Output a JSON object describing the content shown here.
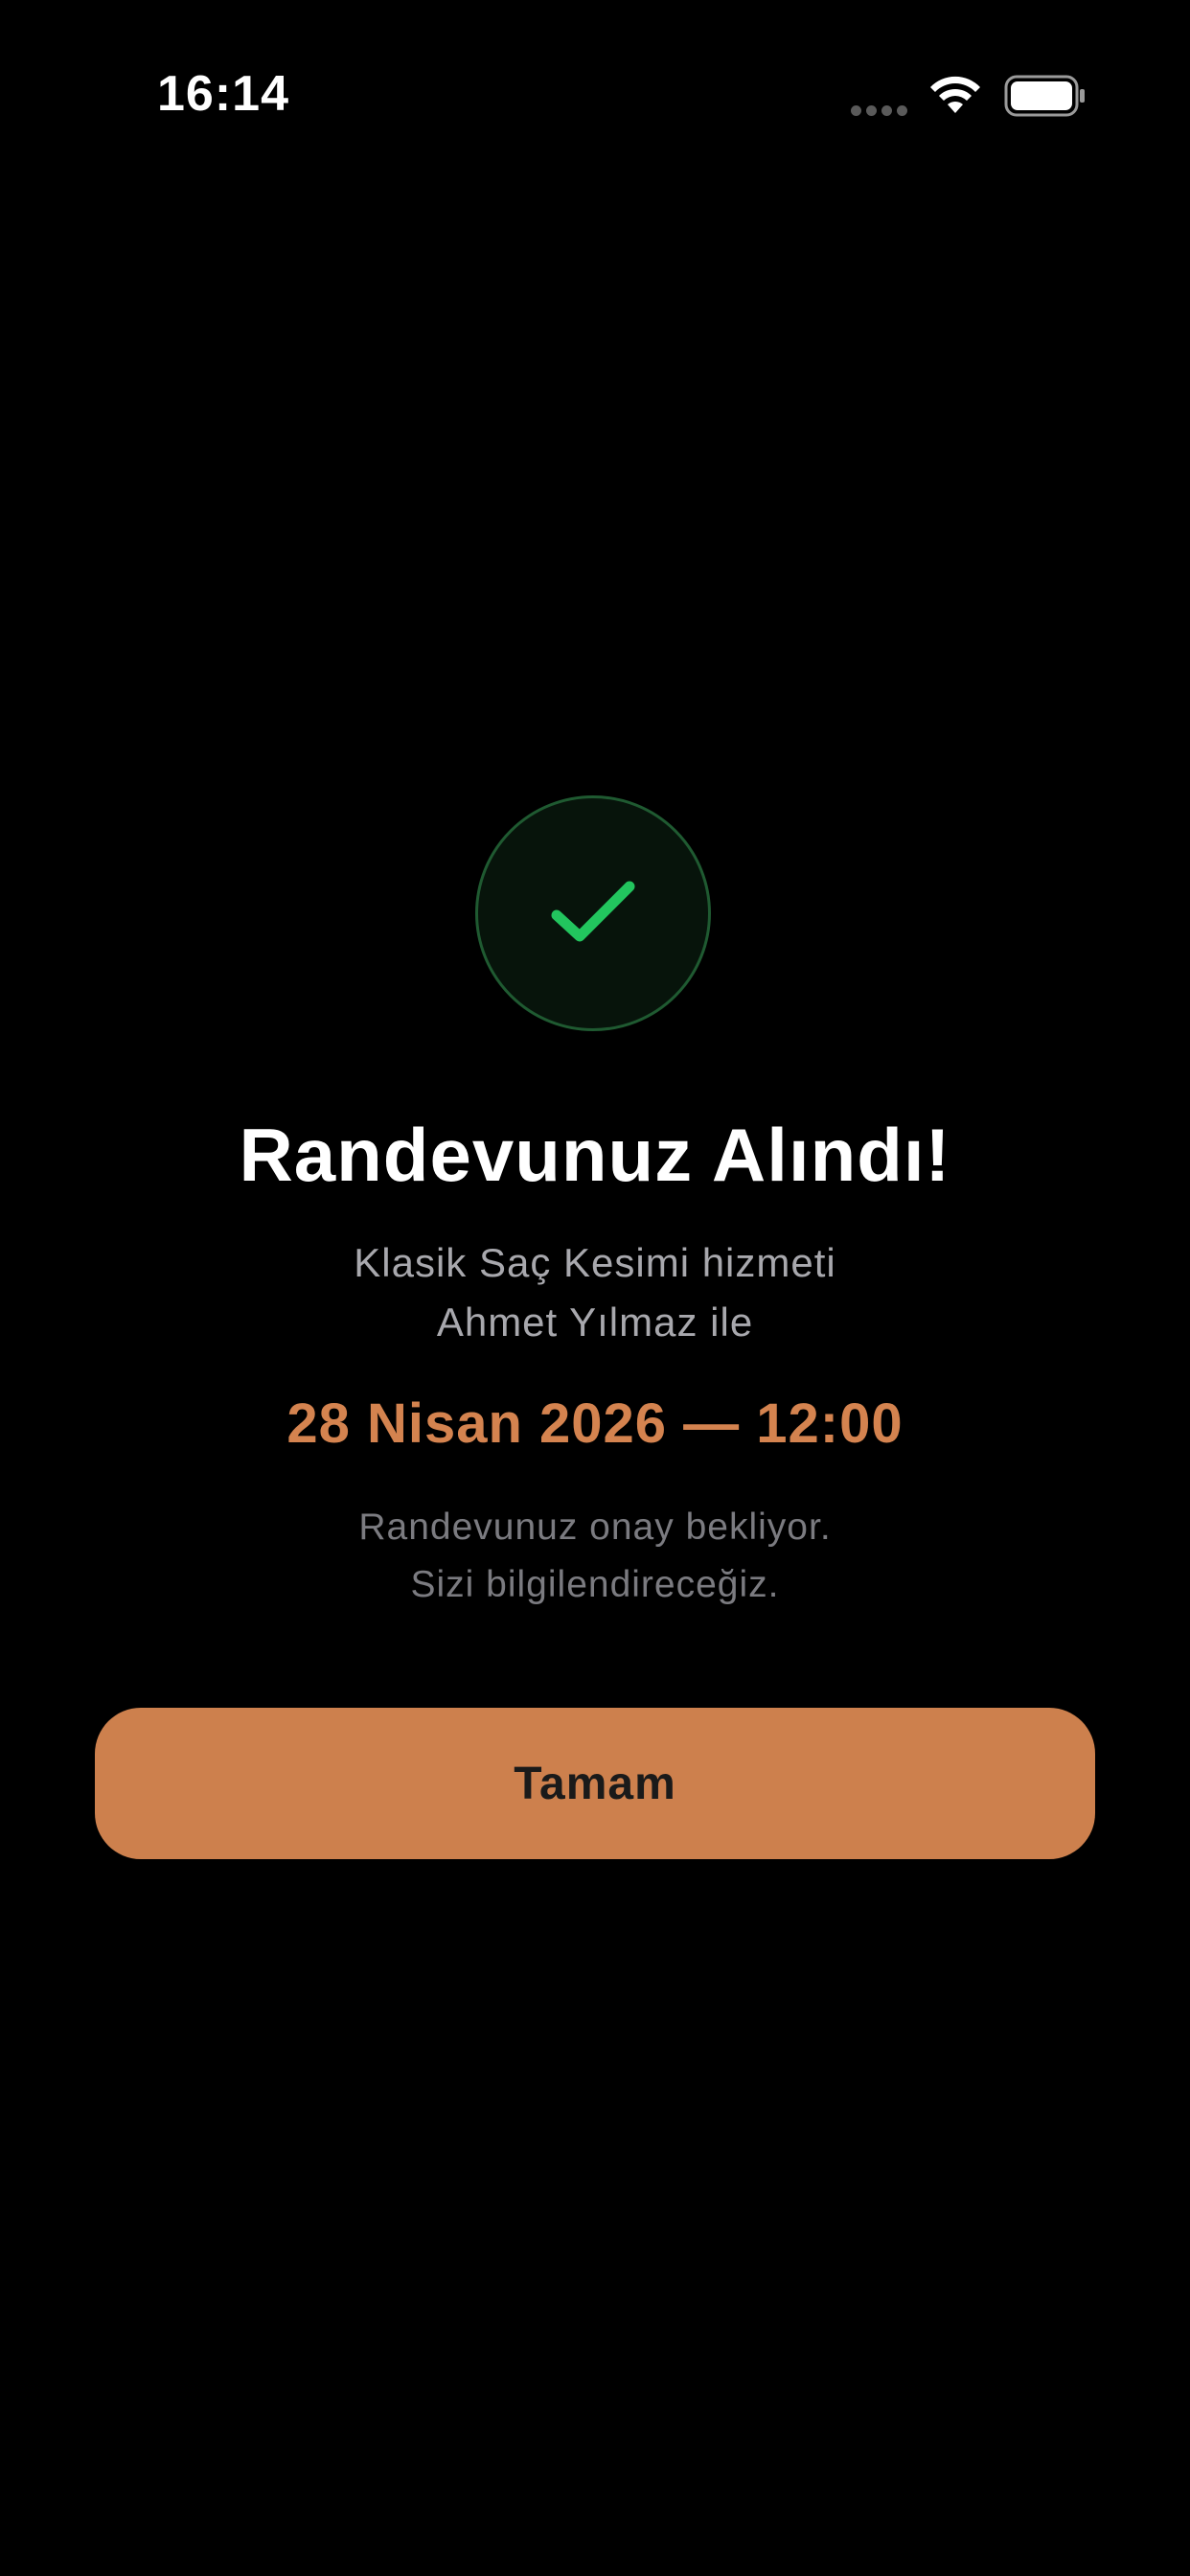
{
  "status_bar": {
    "time": "16:14",
    "signal_icon": "signal-dots-icon",
    "wifi_icon": "wifi-icon",
    "battery_icon": "battery-icon"
  },
  "confirmation": {
    "icon": "check-icon",
    "title": "Randevunuz Alındı!",
    "service_line": "Klasik Saç Kesimi hizmeti",
    "staff_line": "Ahmet Yılmaz ile",
    "datetime": "28 Nisan 2026 — 12:00",
    "status_line_1": "Randevunuz onay bekliyor.",
    "status_line_2": "Sizi bilgilendireceğiz.",
    "ok_label": "Tamam"
  },
  "colors": {
    "background": "#000000",
    "accent": "#cd804d",
    "datetime_text": "#d4834f",
    "success_green": "#22c55e",
    "badge_background": "#07140b"
  }
}
